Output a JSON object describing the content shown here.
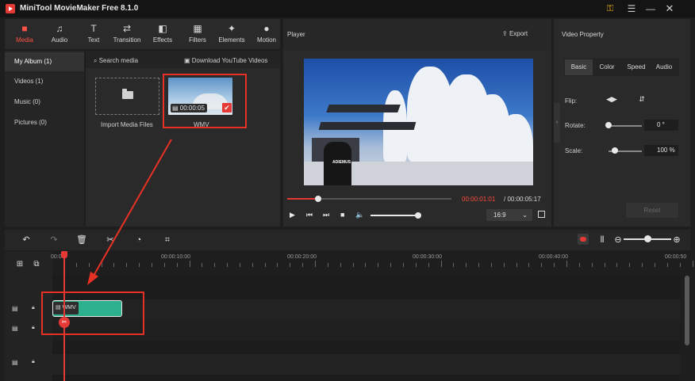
{
  "app": {
    "title": "MiniTool MovieMaker Free 8.1.0"
  },
  "media_tabs": [
    {
      "label": "Media",
      "icon": "folder-icon",
      "active": true
    },
    {
      "label": "Audio",
      "icon": "music-note-icon"
    },
    {
      "label": "Text",
      "icon": "text-icon"
    },
    {
      "label": "Transition",
      "icon": "transition-icon"
    },
    {
      "label": "Effects",
      "icon": "effects-icon"
    },
    {
      "label": "Filters",
      "icon": "filters-icon"
    },
    {
      "label": "Elements",
      "icon": "elements-icon"
    },
    {
      "label": "Motion",
      "icon": "motion-icon"
    }
  ],
  "sidebar": {
    "items": [
      {
        "label": "My Album (1)",
        "active": true
      },
      {
        "label": "Videos (1)"
      },
      {
        "label": "Music (0)"
      },
      {
        "label": "Pictures (0)"
      }
    ]
  },
  "media": {
    "search_label": "Search media",
    "download_label": "Download YouTube Videos",
    "import_label": "Import Media Files",
    "clip_name": "WMV",
    "clip_duration": "00:00:05"
  },
  "player": {
    "title": "Player",
    "export_label": "Export",
    "time_current": "00:00:01:01",
    "time_total": "/ 00:00:05:17",
    "progress": 0.19,
    "volume": 1.0,
    "aspect_ratio": "16:9",
    "video_text": "ADIEMUS"
  },
  "property": {
    "title": "Video Property",
    "tabs": [
      "Basic",
      "Color",
      "Speed",
      "Audio"
    ],
    "flip_label": "Flip:",
    "rotate_label": "Rotate:",
    "rotate_value": "0 °",
    "rotate_level": 0.0,
    "scale_label": "Scale:",
    "scale_value": "100 %",
    "scale_level": 0.2,
    "reset_label": "Reset"
  },
  "timeline": {
    "ruler_labels": [
      "00:00",
      "00:00:10:00",
      "00:00:20:00",
      "00:00:30:00",
      "00:00:40:00",
      "00:00:50"
    ],
    "clip_label": "WMV",
    "zoom_level": 0.5
  },
  "colors": {
    "accent": "#e53935",
    "clip": "#2db08d",
    "highlight_box": "#e83125"
  }
}
